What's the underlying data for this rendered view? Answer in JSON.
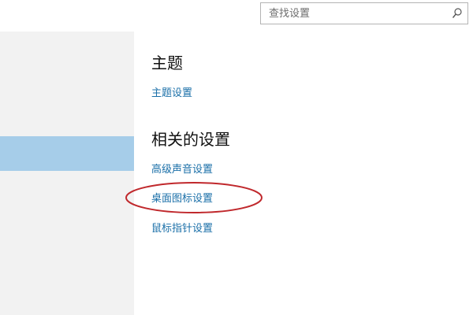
{
  "search": {
    "placeholder": "查找设置",
    "icon": "search-icon"
  },
  "sidebar": {
    "selected_color": "#a6cde9"
  },
  "content": {
    "theme_section": {
      "heading": "主题",
      "links": [
        "主题设置"
      ]
    },
    "related_section": {
      "heading": "相关的设置",
      "links": [
        "高级声音设置",
        "桌面图标设置",
        "鼠标指针设置"
      ]
    },
    "annotation": {
      "highlighted_item": "桌面图标设置",
      "color": "#c0282c"
    }
  },
  "colors": {
    "link": "#1a6fa8",
    "heading": "#111111",
    "sidebar_bg": "#f2f2f2"
  }
}
